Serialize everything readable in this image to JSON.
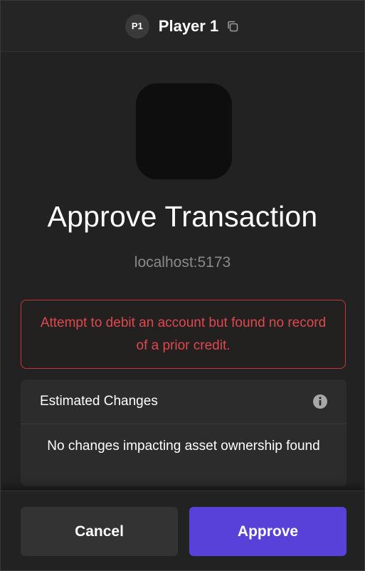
{
  "header": {
    "avatar_initials": "P1",
    "account_name": "Player 1",
    "copy_icon": "copy-icon"
  },
  "dapp": {
    "title": "Approve Transaction",
    "origin": "localhost:5173"
  },
  "error": {
    "message": "Attempt to debit an account but found no record of a prior credit.",
    "color": "#e0474f"
  },
  "estimated_changes": {
    "title": "Estimated Changes",
    "info_icon": "info-icon",
    "message": "No changes impacting asset ownership found"
  },
  "footer": {
    "cancel_label": "Cancel",
    "approve_label": "Approve",
    "approve_color": "#5741d9"
  }
}
